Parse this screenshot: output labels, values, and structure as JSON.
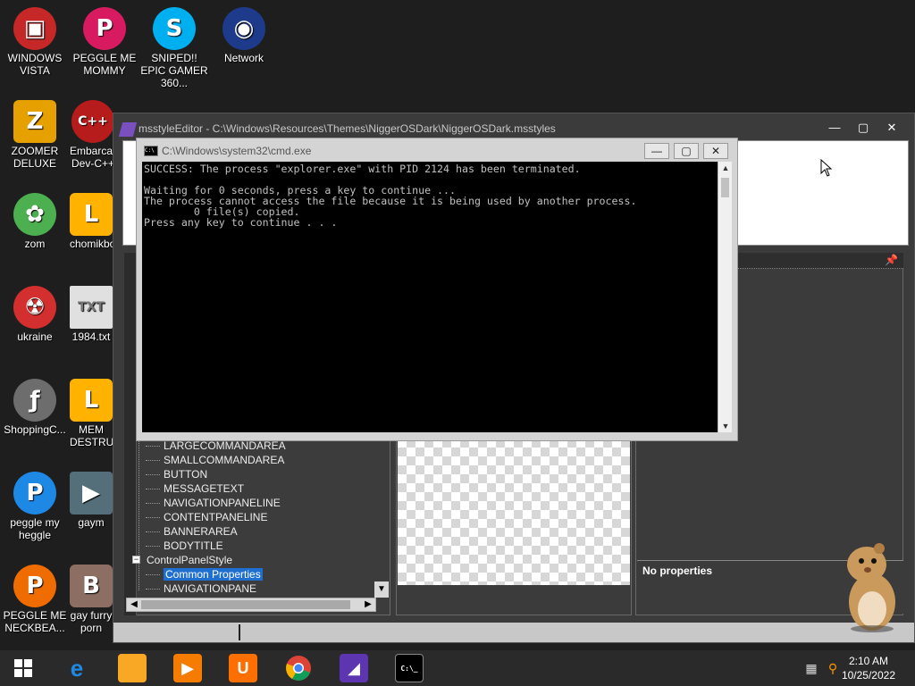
{
  "desktop_icons": [
    {
      "label": "WINDOWS VISTA",
      "icon": "vista-icon",
      "color": "#c62828"
    },
    {
      "label": "PEGGLE ME MOMMY",
      "icon": "peggle-icon",
      "color": "#d81b60"
    },
    {
      "label": "SNIPED!! EPIC GAMER 360...",
      "icon": "skype-icon",
      "color": "#00aff0"
    },
    {
      "label": "Network",
      "icon": "network-icon",
      "color": "#1e3a8a"
    },
    {
      "label": "ZOOMER DELUXE",
      "icon": "zoomer-icon",
      "color": "#e6a100"
    },
    {
      "label": "Embarcadero Dev-C++",
      "icon": "devcpp-icon",
      "color": "#b71c1c"
    },
    {
      "label": "zom",
      "icon": "plant-icon",
      "color": "#4caf50"
    },
    {
      "label": "chomikbox",
      "icon": "chomik-icon",
      "color": "#ffb300"
    },
    {
      "label": "ukraine",
      "icon": "radiation-icon",
      "color": "#d32f2f"
    },
    {
      "label": "1984.txt",
      "icon": "text-file-icon",
      "color": "#9e9e9e"
    },
    {
      "label": "ShoppingC...",
      "icon": "flash-icon",
      "color": "#6d6d6d"
    },
    {
      "label": "MEM DESTRUCT",
      "icon": "mem-icon",
      "color": "#ffb300"
    },
    {
      "label": "peggle my heggle",
      "icon": "peggle-icon",
      "color": "#d81b60"
    },
    {
      "label": "gaym",
      "icon": "gaym-icon",
      "color": "#546e7a"
    },
    {
      "label": "PEGGLE ME NECKBEA...",
      "icon": "peggle-icon",
      "color": "#d81b60"
    },
    {
      "label": "gay furry porn",
      "icon": "bear-icon",
      "color": "#8d6e63"
    }
  ],
  "mse_window": {
    "title": "msstyleEditor - C:\\Windows\\Resources\\Themes\\NiggerOSDark\\NiggerOSDark.msstyles",
    "minimize": "—",
    "maximize": "▢",
    "close": "✕"
  },
  "tree": {
    "items": [
      {
        "label": "LARGECOMMANDAREA",
        "selected": false,
        "parent": false
      },
      {
        "label": "SMALLCOMMANDAREA",
        "selected": false,
        "parent": false
      },
      {
        "label": "BUTTON",
        "selected": false,
        "parent": false
      },
      {
        "label": "MESSAGETEXT",
        "selected": false,
        "parent": false
      },
      {
        "label": "NAVIGATIONPANELINE",
        "selected": false,
        "parent": false
      },
      {
        "label": "CONTENTPANELINE",
        "selected": false,
        "parent": false
      },
      {
        "label": "BANNERAREA",
        "selected": false,
        "parent": false
      },
      {
        "label": "BODYTITLE",
        "selected": false,
        "parent": false
      },
      {
        "label": "ControlPanelStyle",
        "selected": false,
        "parent": true
      },
      {
        "label": "Common Properties",
        "selected": true,
        "parent": false
      },
      {
        "label": "NAVIGATIONPANE",
        "selected": false,
        "parent": false
      }
    ]
  },
  "properties": {
    "empty_text": "No properties"
  },
  "cmd_window": {
    "title": "C:\\Windows\\system32\\cmd.exe",
    "minimize": "—",
    "maximize": "▢",
    "close": "✕",
    "output": "SUCCESS: The process \"explorer.exe\" with PID 2124 has been terminated.\n\nWaiting for 0 seconds, press a key to continue ...\nThe process cannot access the file because it is being used by another process.\n        0 file(s) copied.\nPress any key to continue . . ."
  },
  "taskbar": {
    "items": [
      {
        "name": "start-button",
        "icon": "windows-logo-icon",
        "color": "#ffffff"
      },
      {
        "name": "internet-explorer",
        "icon": "ie-icon",
        "color": "#1e88e5"
      },
      {
        "name": "file-explorer",
        "icon": "folder-icon",
        "color": "#f9a825"
      },
      {
        "name": "media-player",
        "icon": "media-icon",
        "color": "#f57c00"
      },
      {
        "name": "uc-browser",
        "icon": "uc-icon",
        "color": "#ff6f00"
      },
      {
        "name": "chrome",
        "icon": "chrome-icon",
        "color": "#4caf50"
      },
      {
        "name": "msstyleeditor",
        "icon": "msstyleeditor-icon",
        "color": "#7e57c2"
      },
      {
        "name": "cmd",
        "icon": "cmd-icon",
        "color": "#000000"
      }
    ],
    "time": "2:10 AM",
    "date": "10/25/2022"
  }
}
